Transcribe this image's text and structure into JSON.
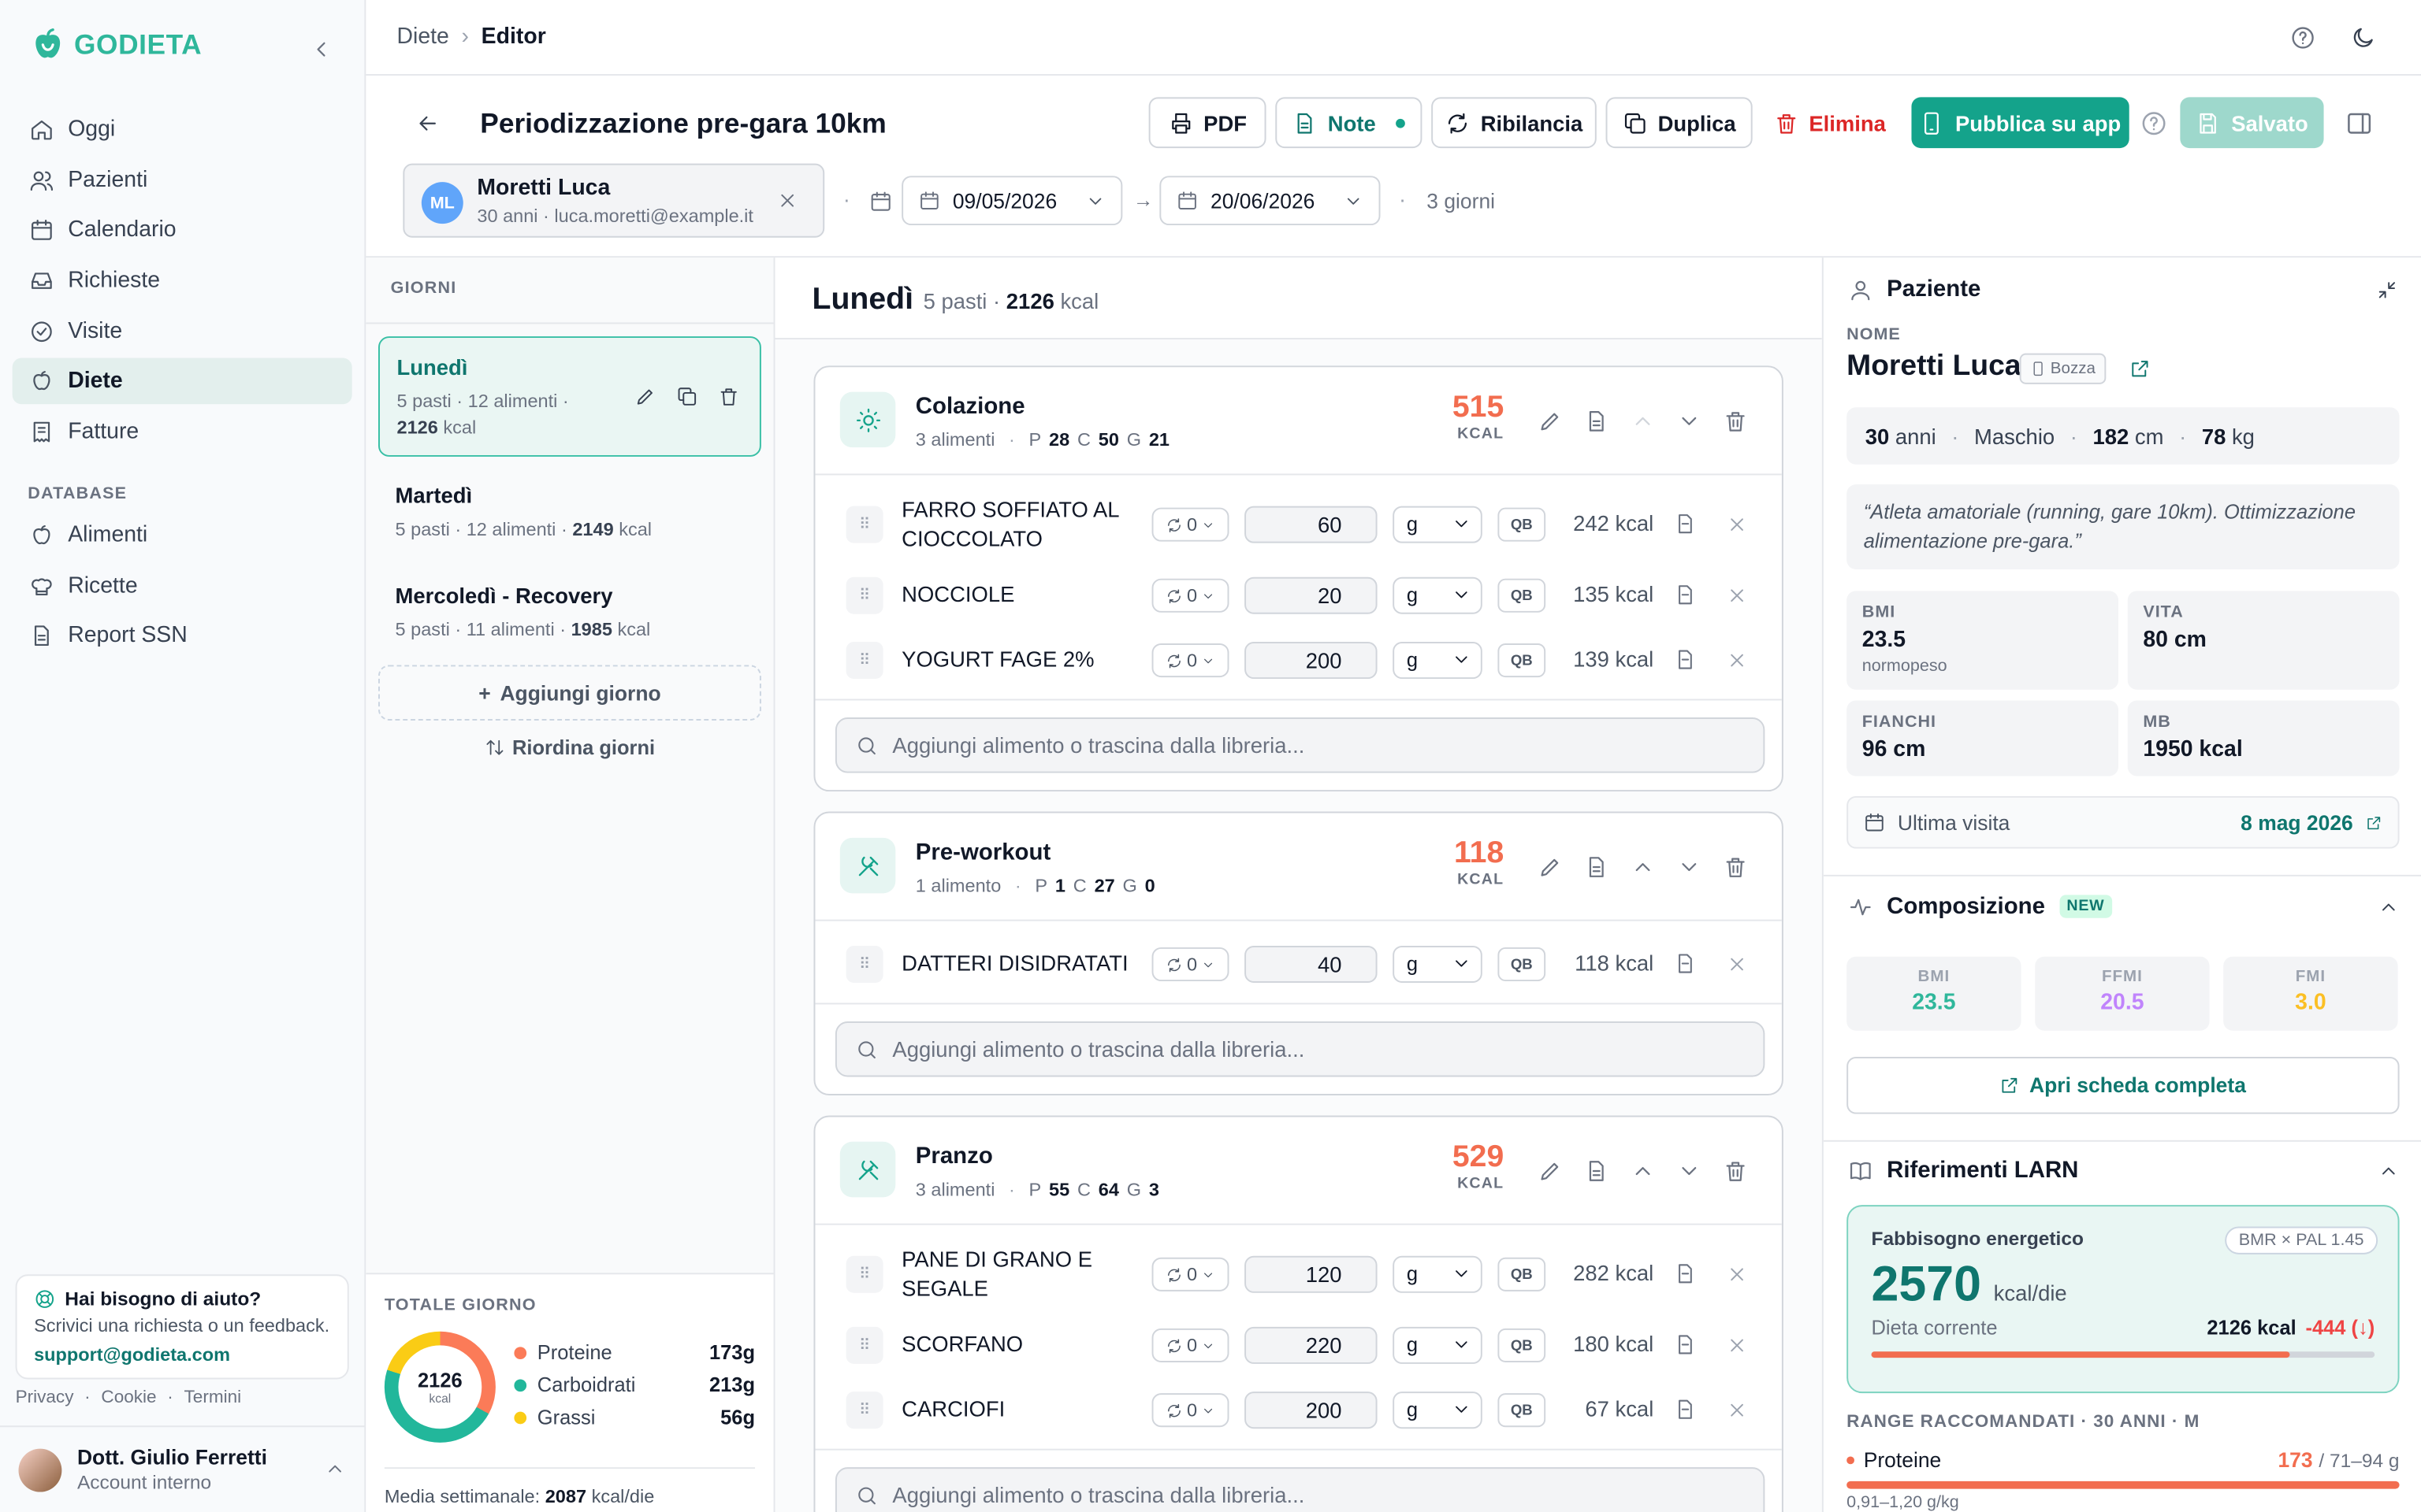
{
  "brand": {
    "name": "GODIETA"
  },
  "sidebar": {
    "nav": [
      {
        "label": "Oggi",
        "icon": "home-icon"
      },
      {
        "label": "Pazienti",
        "icon": "users-icon"
      },
      {
        "label": "Calendario",
        "icon": "calendar-icon"
      },
      {
        "label": "Richieste",
        "icon": "inbox-icon"
      },
      {
        "label": "Visite",
        "icon": "check-circle-icon"
      },
      {
        "label": "Diete",
        "icon": "apple-icon",
        "active": true
      },
      {
        "label": "Fatture",
        "icon": "receipt-icon"
      }
    ],
    "database_label": "DATABASE",
    "db": [
      {
        "label": "Alimenti",
        "icon": "apple-icon"
      },
      {
        "label": "Ricette",
        "icon": "chef-hat-icon"
      },
      {
        "label": "Report SSN",
        "icon": "file-icon"
      }
    ],
    "help": {
      "title": "Hai bisogno di aiuto?",
      "desc": "Scrivici una richiesta o un feedback.",
      "email": "support@godieta.com"
    },
    "legal": [
      "Privacy",
      "Cookie",
      "Termini"
    ],
    "user": {
      "name": "Dott. Giulio Ferretti",
      "role": "Account interno"
    }
  },
  "breadcrumb": {
    "parent": "Diete",
    "current": "Editor"
  },
  "header": {
    "title": "Periodizzazione pre-gara 10km",
    "buttons": {
      "pdf": "PDF",
      "note": "Note",
      "ribilancia": "Ribilancia",
      "duplica": "Duplica",
      "elimina": "Elimina",
      "pubblica": "Pubblica su app",
      "salvato": "Salvato"
    },
    "patient": {
      "initials": "ML",
      "name": "Moretti Luca",
      "meta": "30 anni · luca.moretti@example.it"
    },
    "start_date": "09/05/2026",
    "end_date": "20/06/2026",
    "days": "3 giorni"
  },
  "days": {
    "label": "GIORNI",
    "items": [
      {
        "name": "Lunedì",
        "meta": "5 pasti · 12 alimenti ·",
        "kcal": "2126",
        "unit": "kcal"
      },
      {
        "name": "Martedì",
        "meta": "5 pasti · 12 alimenti ·",
        "kcal": "2149",
        "unit": "kcal"
      },
      {
        "name": "Mercoledì - Recovery",
        "meta": "5 pasti · 11 alimenti ·",
        "kcal": "1985",
        "unit": "kcal"
      }
    ],
    "add": "Aggiungi giorno",
    "reorder": "Riordina giorni",
    "totals": {
      "label": "TOTALE GIORNO",
      "kcal": "2126",
      "kcal_unit": "kcal",
      "macros": [
        {
          "name": "Proteine",
          "value": "173g",
          "color": "#fb7b58"
        },
        {
          "name": "Carboidrati",
          "value": "213g",
          "color": "#22b79b"
        },
        {
          "name": "Grassi",
          "value": "56g",
          "color": "#facc15"
        }
      ],
      "avg_label": "Media settimanale:",
      "avg_value": "2087",
      "avg_unit": "kcal/die"
    }
  },
  "main": {
    "day": "Lunedì",
    "meals_count": "5 pasti ·",
    "kcal": "2126",
    "kcal_unit": "kcal",
    "add_placeholder": "Aggiungi alimento o trascina dalla libreria...",
    "meals": [
      {
        "name": "Colazione",
        "count": "3 alimenti",
        "p": "28",
        "c": "50",
        "g": "21",
        "kcal": "515",
        "unit": "KCAL",
        "foods": [
          {
            "name": "FARRO SOFFIATO AL CIOCCOLATO",
            "alt": "0",
            "qty": "60",
            "unit": "g",
            "kcal": "242 kcal"
          },
          {
            "name": "NOCCIOLE",
            "alt": "0",
            "qty": "20",
            "unit": "g",
            "kcal": "135 kcal"
          },
          {
            "name": "YOGURT FAGE 2%",
            "alt": "0",
            "qty": "200",
            "unit": "g",
            "kcal": "139 kcal"
          }
        ]
      },
      {
        "name": "Pre-workout",
        "count": "1 alimento",
        "p": "1",
        "c": "27",
        "g": "0",
        "kcal": "118",
        "unit": "KCAL",
        "foods": [
          {
            "name": "DATTERI DISIDRATATI",
            "alt": "0",
            "qty": "40",
            "unit": "g",
            "kcal": "118 kcal"
          }
        ]
      },
      {
        "name": "Pranzo",
        "count": "3 alimenti",
        "p": "55",
        "c": "64",
        "g": "3",
        "kcal": "529",
        "unit": "KCAL",
        "foods": [
          {
            "name": "PANE DI GRANO E SEGALE",
            "alt": "0",
            "qty": "120",
            "unit": "g",
            "kcal": "282 kcal"
          },
          {
            "name": "SCORFANO",
            "alt": "0",
            "qty": "220",
            "unit": "g",
            "kcal": "180 kcal"
          },
          {
            "name": "CARCIOFI",
            "alt": "0",
            "qty": "200",
            "unit": "g",
            "kcal": "67 kcal"
          }
        ]
      }
    ],
    "qb": "QB"
  },
  "patient_panel": {
    "title": "Paziente",
    "name_label": "NOME",
    "name": "Moretti Luca",
    "status": "Bozza",
    "age": "30",
    "age_unit": "anni",
    "sex": "Maschio",
    "height": "182",
    "height_unit": "cm",
    "weight": "78",
    "weight_unit": "kg",
    "note": "“Atleta amatoriale (running, gare 10km). Ottimizzazione alimentazione pre-gara.”",
    "stats": [
      {
        "label": "BMI",
        "value": "23.5",
        "sub": "normopeso"
      },
      {
        "label": "VITA",
        "value": "80 cm"
      },
      {
        "label": "FIANCHI",
        "value": "96 cm"
      },
      {
        "label": "MB",
        "value": "1950 kcal"
      }
    ],
    "last_visit_label": "Ultima visita",
    "last_visit": "8 mag 2026",
    "composition": {
      "title": "Composizione",
      "badge": "NEW",
      "items": [
        {
          "label": "BMI",
          "value": "23.5",
          "color": "#2fb79b"
        },
        {
          "label": "FFMI",
          "value": "20.5",
          "color": "#c084fc"
        },
        {
          "label": "FMI",
          "value": "3.0",
          "color": "#fbbf24"
        }
      ],
      "open": "Apri scheda completa"
    },
    "larn": {
      "title": "Riferimenti LARN",
      "energy_label": "Fabbisogno energetico",
      "formula": "BMR × PAL 1.45",
      "value": "2570",
      "unit": "kcal/die",
      "current_label": "Dieta corrente",
      "current": "2126 kcal",
      "diff": "-444 (↓)",
      "progress": 0.83,
      "range_label": "RANGE RACCOMANDATI · 30 ANNI · M",
      "protein": "Proteine",
      "protein_val": "173",
      "protein_range": "/ 71–94 g",
      "protein_sub": "0,91–1,20 g/kg"
    }
  },
  "colors": {
    "accent": "#14a38b",
    "kcal": "#f26d4f",
    "danger": "#dc2626"
  }
}
